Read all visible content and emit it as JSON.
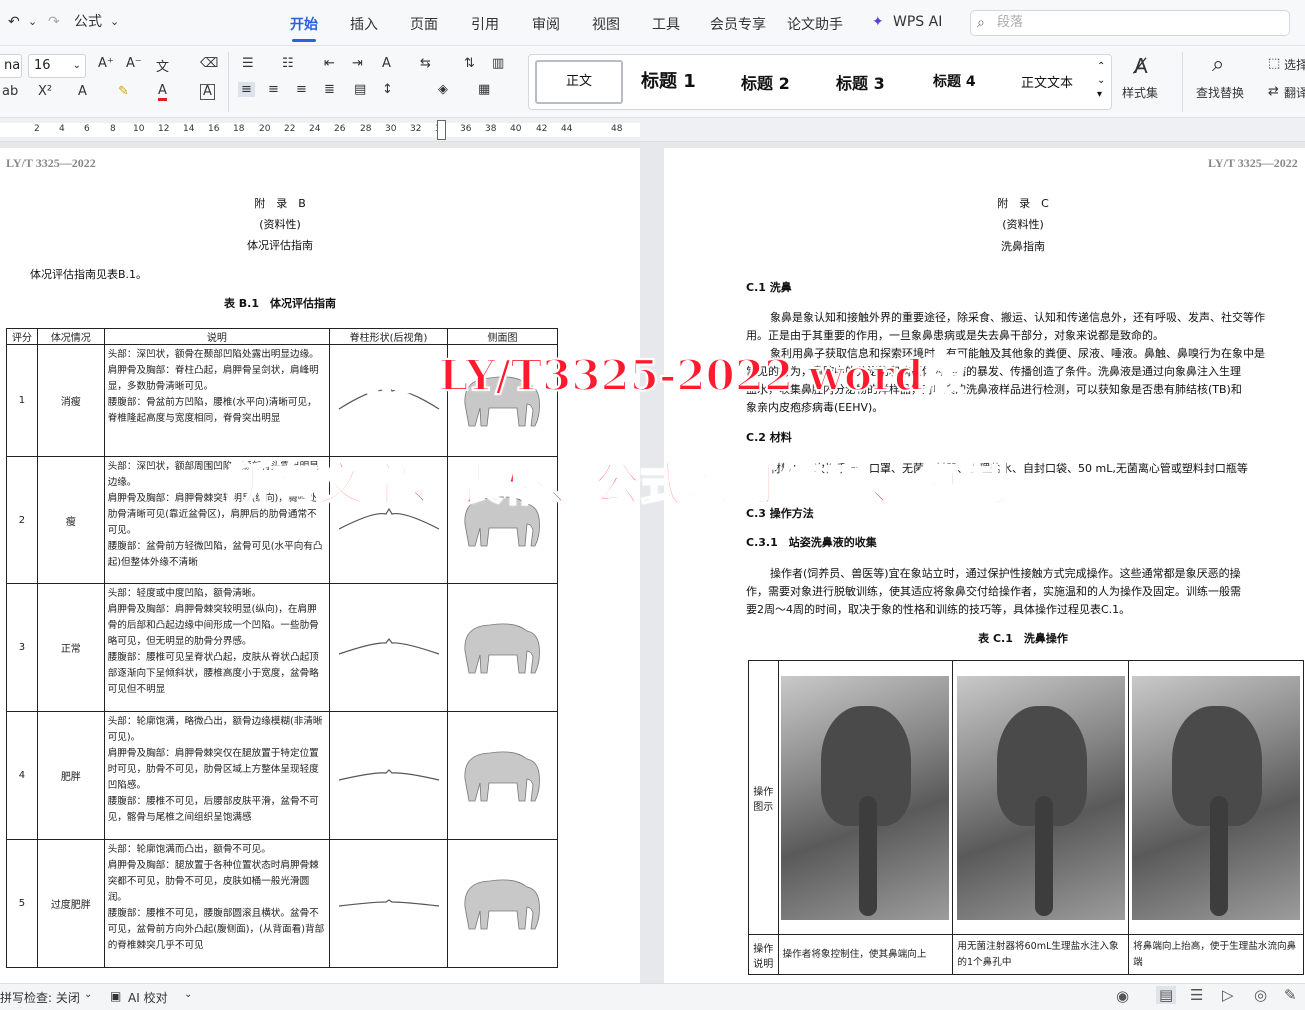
{
  "toolbar": {
    "undo_icon": "↶",
    "dd1": "⌄",
    "redo_icon": "↷",
    "formula": "公式",
    "dd2": "⌄"
  },
  "tabs": [
    "开始",
    "插入",
    "页面",
    "引用",
    "审阅",
    "视图",
    "工具",
    "会员专享",
    "论文助手",
    "WPS AI"
  ],
  "search": {
    "placeholder": "段落"
  },
  "ribbon": {
    "font_name": "na",
    "font_size": "16",
    "styles": [
      "正文",
      "标题 1",
      "标题 2",
      "标题 3",
      "标题 4",
      "正文文本"
    ],
    "styleset": "样式集",
    "find": "查找替换",
    "select": "选择",
    "translate": "翻译"
  },
  "ruler": {
    "ticks": [
      "2",
      "4",
      "6",
      "8",
      "10",
      "12",
      "14",
      "16",
      "18",
      "20",
      "22",
      "24",
      "26",
      "28",
      "30",
      "32",
      "34",
      "36",
      "38",
      "40",
      "42",
      "44",
      "48"
    ]
  },
  "left_page": {
    "header": "LY/T 3325—2022",
    "appendix": "附　录　B",
    "nature": "(资料性)",
    "title": "体况评估指南",
    "intro": "体况评估指南见表B.1。",
    "table_caption": "表 B.1　体况评估指南",
    "columns": [
      "评分",
      "体况情况",
      "说明",
      "脊柱形状(后视角)",
      "侧面图"
    ],
    "rows": [
      {
        "score": "1",
        "cond": "消瘦",
        "desc": [
          "头部：深凹状，额骨在颞部凹陷处露出明显边缘。",
          "肩胛骨及胸部：脊柱凸起，肩胛骨呈剑状，肩峰明显，多数肋骨清晰可见。",
          "腰腹部：骨盆前方凹陷，腰椎(水平向)清晰可见，脊椎隆起高度与宽度相同，脊骨突出明显"
        ]
      },
      {
        "score": "2",
        "cond": "瘦",
        "desc": [
          "头部：深凹状，额部周围凹陷，颞部骨头露出明显边缘。",
          "肩胛骨及胸部：肩胛骨棘突较明显(纵向)，胸腔处肋骨清晰可见(靠近盆骨区)，肩胛后的肋骨通常不可见。",
          "腰腹部：盆骨前方轻微凹陷，盆骨可见(水平向有凸起)但整体外缘不清晰"
        ]
      },
      {
        "score": "3",
        "cond": "正常",
        "desc": [
          "头部：轻度或中度凹陷，额骨清晰。",
          "肩胛骨及胸部：肩胛骨棘突较明显(纵向)，在肩胛骨的后部和凸起边缘中间形成一个凹陷。一些肋骨略可见，但无明显的肋骨分界感。",
          "腰腹部：腰椎可见呈脊状凸起，皮肤从脊状凸起顶部逐渐向下呈倾斜状，腰椎高度小于宽度，盆骨略可见但不明显"
        ]
      },
      {
        "score": "4",
        "cond": "肥胖",
        "desc": [
          "头部：轮廓饱满，略微凸出，额骨边缘模糊(非清晰可见)。",
          "肩胛骨及胸部：肩胛骨棘突仅在腿放置于特定位置时可见，肋骨不可见，肋骨区域上方整体呈现轻度凹陷感。",
          "腰腹部：腰椎不可见，后腰部皮肤平滑，盆骨不可见，髂骨与尾椎之间组织呈饱满感"
        ]
      },
      {
        "score": "5",
        "cond": "过度肥胖",
        "desc": [
          "头部：轮廓饱满而凸出，额骨不可见。",
          "肩胛骨及胸部：腿放置于各种位置状态时肩胛骨棘突都不可见，肋骨不可见，皮肤如桶一般光滑圆润。",
          "腰腹部：腰椎不可见，腰腹部圆滚且横状。盆骨不可见，盆骨前方向外凸起(腹侧面)，(从背面看)背部的脊椎棘突几乎不可见"
        ]
      }
    ]
  },
  "right_page": {
    "header": "LY/T 3325—2022",
    "appendix": "附　录　C",
    "nature": "(资料性)",
    "title": "洗鼻指南",
    "c1_heading": "C.1 洗鼻",
    "c1_text": [
      "象鼻是象认知和接触外界的重要途径，除采食、搬运、认知和传递信息外，还有呼吸、发声、社交等作",
      "用。正是由于其重要的作用，一旦象鼻患病或是失去鼻干部分，对象来说都是致命的。",
      "象利用鼻子获取信息和探索环境时，有可能触及其他象的粪便、尿液、唾液。鼻触、鼻嗅行为在象中是",
      "常见的行为，鼻腔中的分泌物和病原体为疾病的暴发、传播创造了条件。洗鼻液是通过向象鼻注入生理",
      "盐水，收集鼻腔内分泌物的洋样品，对收集的洗鼻液样品进行检测，可以获知象是否患有肺结核(TB)和",
      "象亲内皮疱疹病毒(EEHV)。"
    ],
    "c2_heading": "C.2 材料",
    "c2_text": "材料：一次性手套、口罩、无菌注射器、生理盐水、自封口袋、50 mL,无菌离心管或塑料封口瓶等",
    "c3_heading": "C.3 操作方法",
    "c31_heading": "C.3.1　站姿洗鼻液的收集",
    "c31_text": [
      "操作者(饲养员、兽医等)宜在象站立时，通过保护性接触方式完成操作。这些通常都是象厌恶的操",
      "作，需要对象进行脱敏训练，使其适应将象鼻交付给操作者，实施温和的人为操作及固定。训练一般需",
      "要2周～4周的时间，取决于象的性格和训练的技巧等，具体操作过程见表C.1。"
    ],
    "table_caption": "表 C.1　洗鼻操作",
    "row1_label": "操作图示",
    "row2_label": "操作说明",
    "steps": [
      "操作者将象控制住，使其鼻端向上",
      "用无菌注射器将60mL生理盐水注入象的1个鼻孔中",
      "将鼻端向上抬高，使于生理盐水流向鼻端"
    ]
  },
  "overlay": {
    "line1": "附赠 LY/T3325-2022 word版",
    "line2": "所有文字、表格、公式均可编辑、复制"
  },
  "status": {
    "spell": "拼写检查: 关闭",
    "ai": "AI 校对"
  }
}
